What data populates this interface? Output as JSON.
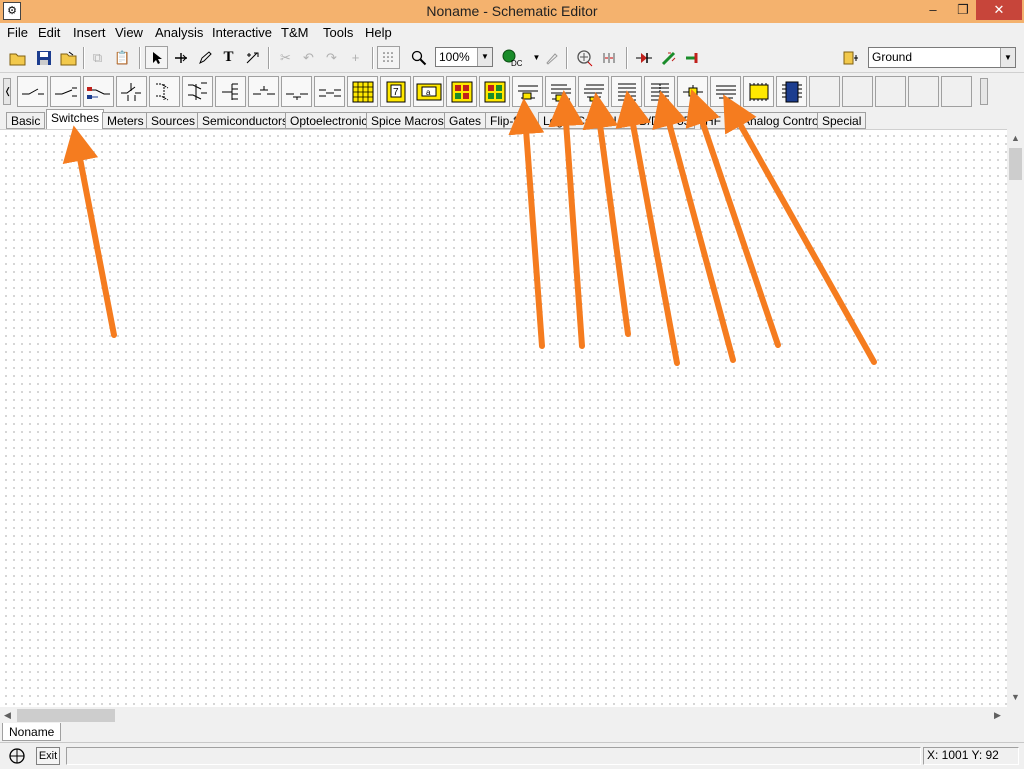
{
  "window": {
    "title": "Noname - Schematic Editor",
    "controls": [
      "–",
      "❐",
      "✕"
    ]
  },
  "menu": [
    "File",
    "Edit",
    "Insert",
    "View",
    "Analysis",
    "Interactive",
    "T&M",
    "Tools",
    "Help"
  ],
  "toolbar": {
    "zoom_value": "100%",
    "ground_select_value": "Ground",
    "dc_label": "DC"
  },
  "tabs": [
    {
      "label": "Basic",
      "active": false
    },
    {
      "label": "Switches",
      "active": true
    },
    {
      "label": "Meters",
      "active": false
    },
    {
      "label": "Sources",
      "active": false
    },
    {
      "label": "Semiconductors",
      "active": false
    },
    {
      "label": "Optoelectronic",
      "active": false
    },
    {
      "label": "Spice Macros",
      "active": false
    },
    {
      "label": "Gates",
      "active": false
    },
    {
      "label": "Flip-f",
      "active": false
    },
    {
      "label": "Logi",
      "active": false
    },
    {
      "label": "ICs",
      "active": false
    },
    {
      "label": "MCUs",
      "active": false
    },
    {
      "label": "D/DA",
      "active": false
    },
    {
      "label": "55",
      "active": false
    },
    {
      "label": "HF",
      "active": false
    },
    {
      "label": "Analog Control",
      "active": false
    },
    {
      "label": "Special",
      "active": false
    }
  ],
  "document_tab": "Noname",
  "status": {
    "exit_label": "Exit",
    "coordinates": "X: 1001  Y: 92"
  },
  "colors": {
    "titlebar": "#f4b26e",
    "close_button": "#c7453a",
    "annotation_arrow": "#f57c1f",
    "component_yellow": "#ffe800"
  }
}
